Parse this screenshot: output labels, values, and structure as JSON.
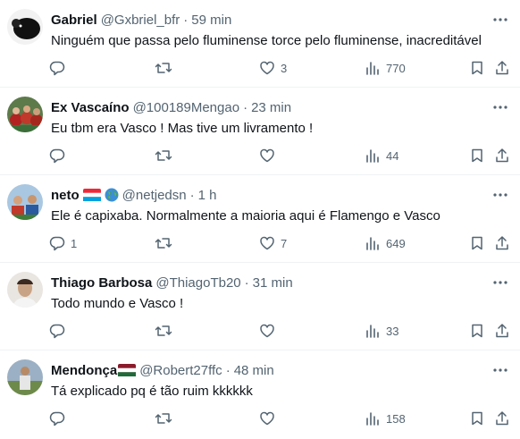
{
  "tweets": [
    {
      "name": "Gabriel",
      "handle": "@Gxbriel_bfr",
      "separator": "·",
      "time": "59 min",
      "text": "Ninguém que passa pelo fluminense torce pelo fluminense, inacreditável",
      "reply_count": "",
      "retweet_count": "",
      "like_count": "3",
      "view_count": "770",
      "avatar_color": "#1a1a1a",
      "flags": []
    },
    {
      "name": "Ex Vascaíno",
      "handle": "@100189Mengao",
      "separator": "·",
      "time": "23 min",
      "text": "Eu tbm era Vasco !  Mas tive um livramento !",
      "reply_count": "",
      "retweet_count": "",
      "like_count": "",
      "view_count": "44",
      "avatar_color": "#8a2a2a",
      "flags": []
    },
    {
      "name": "neto",
      "handle": "@netjedsn",
      "separator": "·",
      "time": "1 h",
      "text": "Ele é capixaba. Normalmente a maioria aqui é Flamengo e Vasco",
      "reply_count": "1",
      "retweet_count": "",
      "like_count": "7",
      "view_count": "649",
      "avatar_color": "#3a6a9a",
      "flags": [
        "luxembourg-flag-icon",
        "globe-icon"
      ]
    },
    {
      "name": "Thiago Barbosa",
      "handle": "@ThiagoTb20",
      "separator": "·",
      "time": "31 min",
      "text": "Todo mundo e Vasco !",
      "reply_count": "",
      "retweet_count": "",
      "like_count": "",
      "view_count": "33",
      "avatar_color": "#d9d4cc",
      "flags": []
    },
    {
      "name": "Mendonça",
      "handle": "@Robert27ffc",
      "separator": "·",
      "time": "48 min",
      "text": "Tá explicado pq é tão ruim kkkkkk",
      "reply_count": "",
      "retweet_count": "",
      "like_count": "",
      "view_count": "158",
      "avatar_color": "#7c8b6a",
      "flags": [
        "fluminense-flag-icon"
      ]
    }
  ],
  "icons": {
    "reply": "reply-icon",
    "retweet": "retweet-icon",
    "like": "heart-icon",
    "views": "views-icon",
    "bookmark": "bookmark-icon",
    "share": "share-icon",
    "more": "more-icon"
  },
  "colors": {
    "text": "#0f1419",
    "secondary": "#536471",
    "divider": "#eff3f4"
  }
}
